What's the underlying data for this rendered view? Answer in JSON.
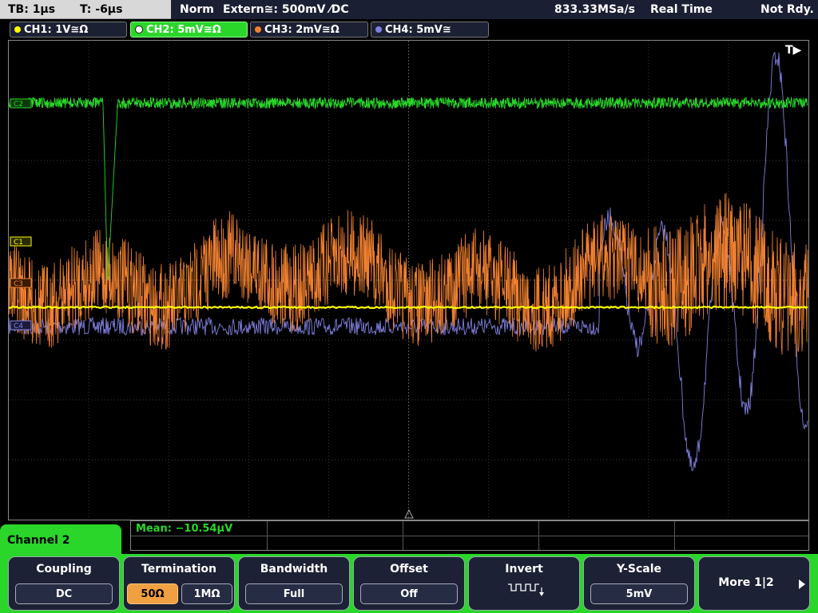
{
  "topbar": {
    "timebase": "TB: 1µs",
    "trigger_time": "T: -6µs",
    "mode": "Norm",
    "trigger_source": "Extern≅: 500mV ⁄DC",
    "sample_rate": "833.33MSa/s",
    "acq_mode": "Real Time",
    "status": "Not Rdy."
  },
  "channels": [
    {
      "label": "CH1: 1V≅Ω",
      "color": "#ffff00"
    },
    {
      "label": "CH2: 5mV≅Ω",
      "color": "#29d629"
    },
    {
      "label": "CH3: 2mV≅Ω",
      "color": "#f08030"
    },
    {
      "label": "CH4: 5mV≅",
      "color": "#8080e0"
    }
  ],
  "screen": {
    "trigger_marker": "T▶",
    "markers": {
      "c2": "C2",
      "c1": "C1",
      "c3": "C3",
      "c4": "C4"
    }
  },
  "measurement": {
    "mean": "Mean: −10.54µV"
  },
  "menu": {
    "title": "Channel 2",
    "coupling": {
      "label": "Coupling",
      "value": "DC"
    },
    "termination": {
      "label": "Termination",
      "options": [
        "50Ω",
        "1MΩ"
      ],
      "selected": "50Ω"
    },
    "bandwidth": {
      "label": "Bandwidth",
      "value": "Full"
    },
    "offset": {
      "label": "Offset",
      "value": "Off"
    },
    "invert": {
      "label": "Invert",
      "icon": "invert-square-wave-icon"
    },
    "yscale": {
      "label": "Y-Scale",
      "value": "5mV"
    },
    "more": {
      "label": "More 1|2"
    }
  },
  "colors": {
    "grid": "#3a3a3a",
    "ch1": "#ffff00",
    "ch2": "#29d629",
    "ch3": "#f08030",
    "ch4": "#8080e0",
    "accent": "#29d629"
  }
}
